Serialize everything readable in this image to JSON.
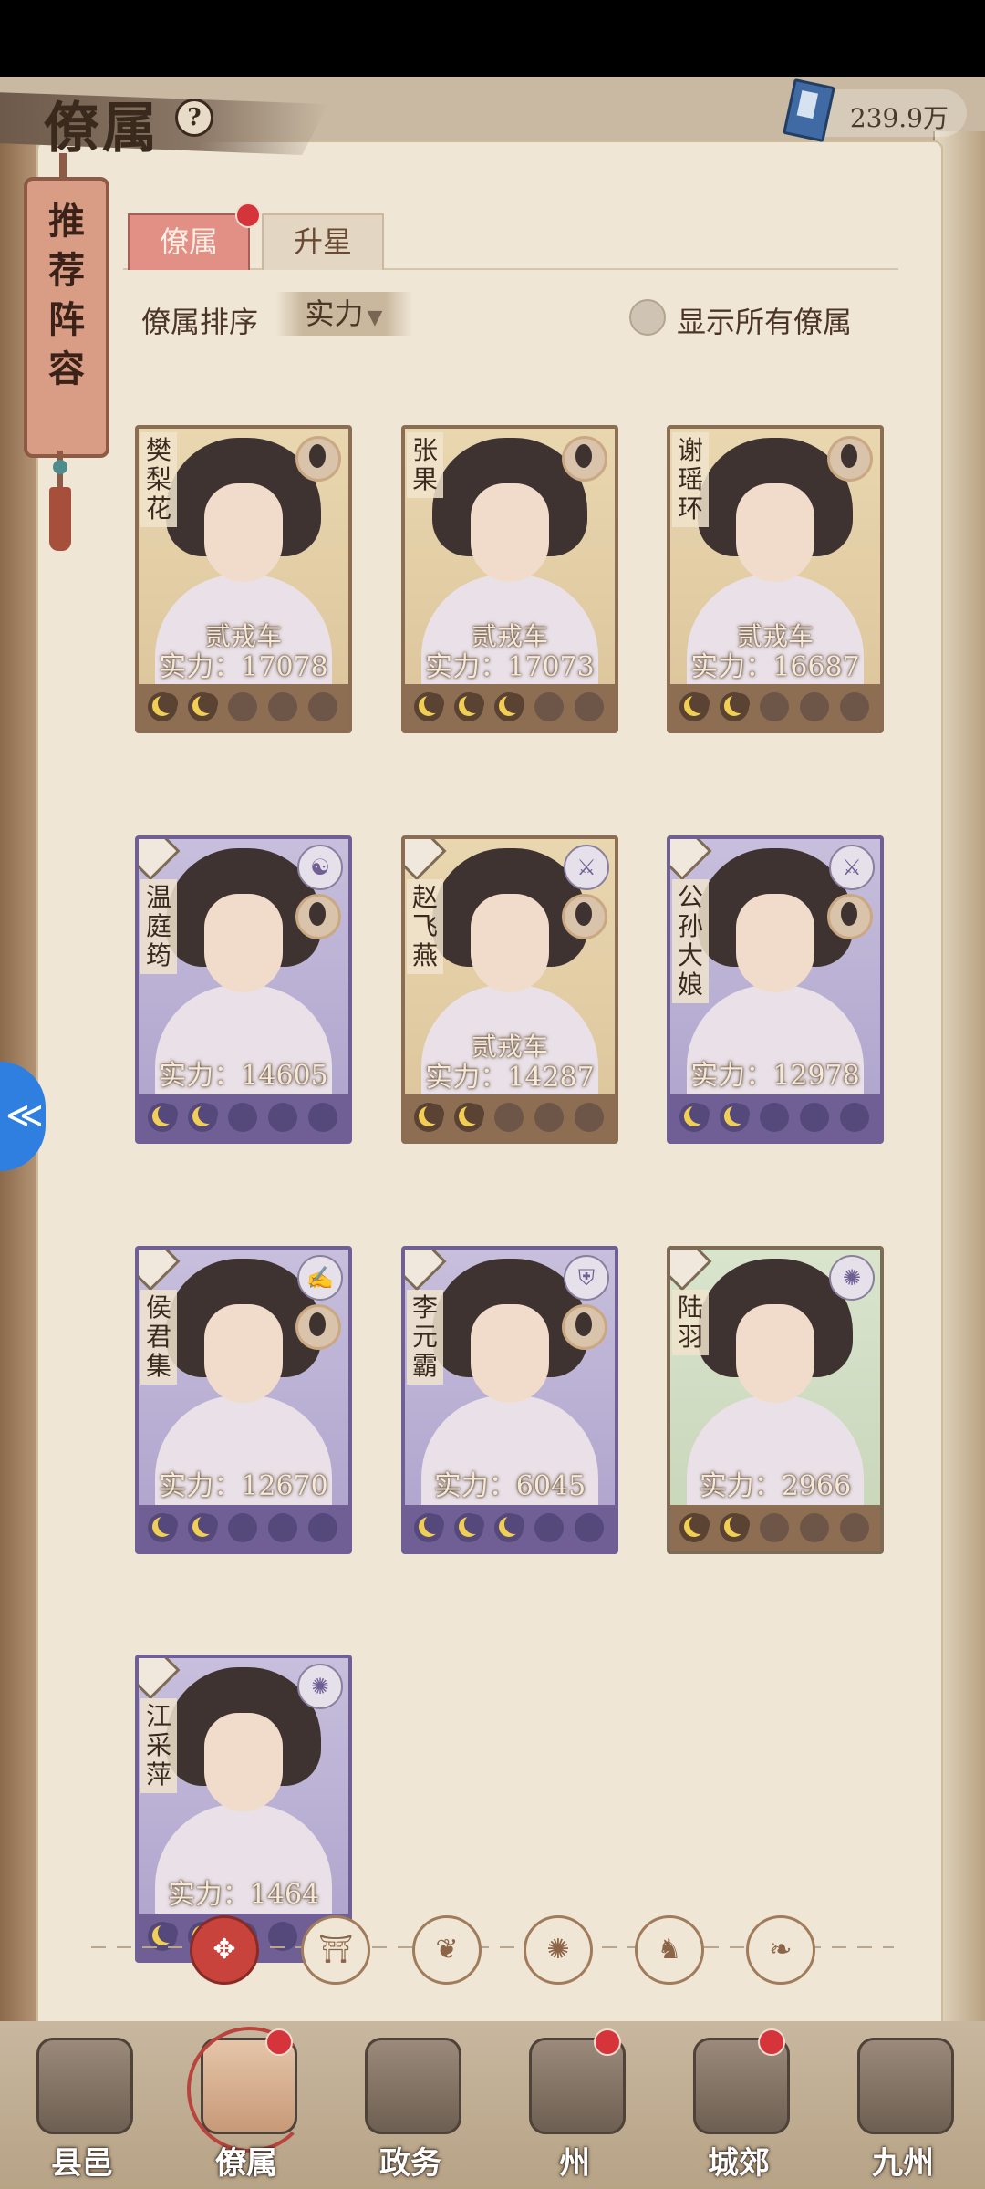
{
  "header": {
    "title": "僚属",
    "help_icon": "?",
    "currency_value": "239.9万"
  },
  "recommend": {
    "label": "推荐阵容"
  },
  "tabs": [
    {
      "label": "僚属",
      "has_badge": true
    },
    {
      "label": "升星"
    }
  ],
  "sort": {
    "label": "僚属排序",
    "selected": "实力"
  },
  "show_all": {
    "label": "显示所有僚属",
    "checked": false
  },
  "cards": [
    {
      "name": "樊梨花",
      "rank": "贰戎车",
      "power": "实力：17078",
      "stars": 2,
      "frame": "gold"
    },
    {
      "name": "张果",
      "rank": "贰戎车",
      "power": "实力：17073",
      "stars": 3,
      "frame": "gold"
    },
    {
      "name": "谢瑶环",
      "rank": "贰戎车",
      "power": "实力：16687",
      "stars": 2,
      "frame": "gold"
    },
    {
      "name": "温庭筠",
      "rank": "",
      "power": "实力：14605",
      "stars": 2,
      "frame": "purple"
    },
    {
      "name": "赵飞燕",
      "rank": "贰戎车",
      "power": "实力：14287",
      "stars": 2,
      "frame": "gold"
    },
    {
      "name": "公孙大娘",
      "rank": "",
      "power": "实力：12978",
      "stars": 2,
      "frame": "purple"
    },
    {
      "name": "侯君集",
      "rank": "",
      "power": "实力：12670",
      "stars": 2,
      "frame": "purple"
    },
    {
      "name": "李元霸",
      "rank": "",
      "power": "实力：6045",
      "stars": 3,
      "frame": "purple"
    },
    {
      "name": "陆羽",
      "rank": "",
      "power": "实力：2966",
      "stars": 2,
      "frame": "green"
    },
    {
      "name": "江采萍",
      "rank": "",
      "power": "实力：1464",
      "stars": 2,
      "frame": "purple"
    }
  ],
  "filters": [
    {
      "icon": "all-diamond-icon",
      "glyph": "✥",
      "active": true
    },
    {
      "icon": "faction-bell-icon",
      "glyph": "⛩"
    },
    {
      "icon": "faction-gourd-icon",
      "glyph": "❦"
    },
    {
      "icon": "faction-fan-icon",
      "glyph": "✺"
    },
    {
      "icon": "faction-beast-icon",
      "glyph": "♞"
    },
    {
      "icon": "faction-leaf-icon",
      "glyph": "❧"
    }
  ],
  "nav": [
    {
      "label": "县邑",
      "has_badge": false
    },
    {
      "label": "僚属",
      "has_badge": true,
      "selected": true
    },
    {
      "label": "政务",
      "has_badge": false
    },
    {
      "label": "州",
      "has_badge": true
    },
    {
      "label": "城郊",
      "has_badge": true
    },
    {
      "label": "九州",
      "has_badge": false
    }
  ]
}
